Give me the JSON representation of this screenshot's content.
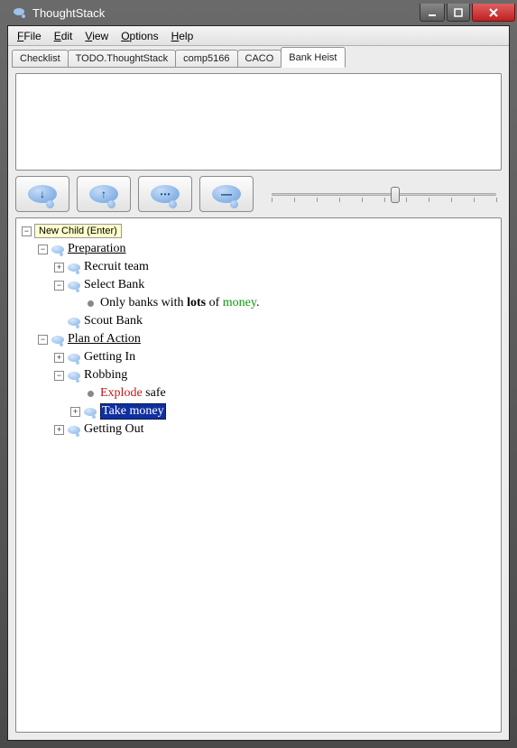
{
  "window": {
    "title": "ThoughtStack"
  },
  "menu": {
    "file": "File",
    "edit": "Edit",
    "view": "View",
    "options": "Options",
    "help": "Help"
  },
  "tabs": [
    {
      "label": "Checklist",
      "active": false
    },
    {
      "label": "TODO.ThoughtStack",
      "active": false
    },
    {
      "label": "comp5166",
      "active": false
    },
    {
      "label": "CACO",
      "active": false
    },
    {
      "label": "Bank Heist",
      "active": true
    }
  ],
  "toolbar": {
    "btn1_tooltip": "New Child (Enter)",
    "btn1_glyph": "↓",
    "btn2_glyph": "↑",
    "btn3_glyph": "⋯",
    "btn4_glyph": "—",
    "slider_value": 0.55,
    "slider_ticks": 11
  },
  "tree": {
    "root_label": "New Child (Enter)",
    "nodes": [
      {
        "depth": 1,
        "toggle": "-",
        "icon": "bubble",
        "text": "Preparation",
        "underline": true
      },
      {
        "depth": 2,
        "toggle": "+",
        "icon": "bubble",
        "text": "Recruit team"
      },
      {
        "depth": 2,
        "toggle": "-",
        "icon": "bubble",
        "text": "Select Bank"
      },
      {
        "depth": 3,
        "toggle": "",
        "icon": "dot",
        "segments": [
          {
            "t": "Only banks with "
          },
          {
            "t": "lots",
            "bold": true
          },
          {
            "t": " of "
          },
          {
            "t": "money",
            "color": "green"
          },
          {
            "t": "."
          }
        ]
      },
      {
        "depth": 2,
        "toggle": "",
        "icon": "bubble",
        "text": "Scout Bank"
      },
      {
        "depth": 1,
        "toggle": "-",
        "icon": "bubble",
        "text": "Plan of Action",
        "underline": true
      },
      {
        "depth": 2,
        "toggle": "+",
        "icon": "bubble",
        "text": "Getting In"
      },
      {
        "depth": 2,
        "toggle": "-",
        "icon": "bubble",
        "text": "Robbing"
      },
      {
        "depth": 3,
        "toggle": "",
        "icon": "dot",
        "segments": [
          {
            "t": "Explode",
            "color": "red"
          },
          {
            "t": " safe"
          }
        ]
      },
      {
        "depth": 3,
        "toggle": "+",
        "icon": "bubble",
        "text": "Take money",
        "selected": true
      },
      {
        "depth": 2,
        "toggle": "+",
        "icon": "bubble",
        "text": "Getting Out"
      }
    ]
  }
}
